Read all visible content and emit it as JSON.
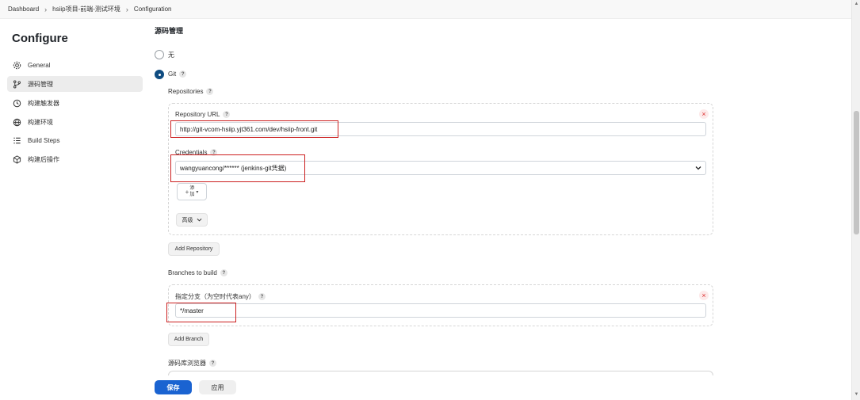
{
  "breadcrumb": [
    "Dashboard",
    "hsiip项目-前端-测试环境",
    "Configuration"
  ],
  "sidebar": {
    "title": "Configure",
    "items": [
      {
        "label": "General",
        "icon": "gear-icon"
      },
      {
        "label": "源码管理",
        "icon": "branch-icon"
      },
      {
        "label": "构建触发器",
        "icon": "clock-icon"
      },
      {
        "label": "构建环境",
        "icon": "globe-icon"
      },
      {
        "label": "Build Steps",
        "icon": "list-icon"
      },
      {
        "label": "构建后操作",
        "icon": "package-icon"
      }
    ],
    "active_index": 1
  },
  "main": {
    "section_title": "源码管理",
    "scm_options": [
      {
        "label": "无",
        "selected": false
      },
      {
        "label": "Git",
        "selected": true
      }
    ],
    "repositories_label": "Repositories",
    "repository": {
      "url_label": "Repository URL",
      "url_value": "http://git-vcom-hsiip.yjt361.com/dev/hsiip-front.git",
      "credentials_label": "Credentials",
      "credentials_value": "wangyuancong/****** (jenkins-git凭据)",
      "add_label_top": "添",
      "add_label_bottom": "加",
      "advanced_label": "高级"
    },
    "add_repository_label": "Add Repository",
    "branches_label": "Branches to build",
    "branch": {
      "specifier_label": "指定分支（为空时代表any）",
      "specifier_value": "*/master"
    },
    "add_branch_label": "Add Branch",
    "repo_browser_label": "源码库浏览器",
    "help_symbol": "?",
    "close_symbol": "×"
  },
  "footer": {
    "save_label": "保存",
    "apply_label": "应用"
  },
  "colors": {
    "primary": "#1a63d1",
    "highlight": "#cc1f1f",
    "radio_checked": "#0f4c81"
  }
}
